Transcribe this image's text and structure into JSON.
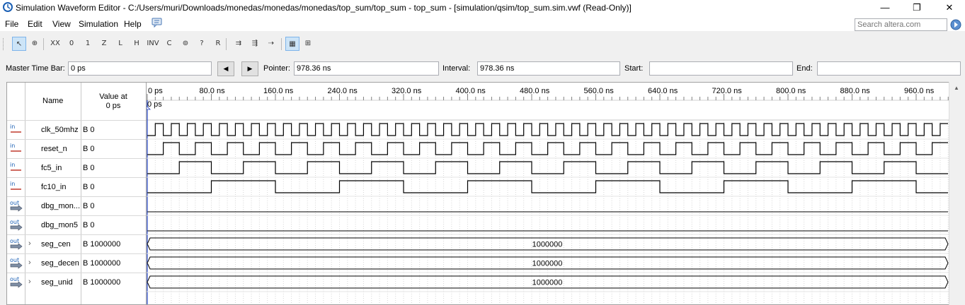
{
  "window": {
    "title": "Simulation Waveform Editor - C:/Users/muri/Downloads/monedas/monedas/monedas/top_sum/top_sum - top_sum - [simulation/qsim/top_sum.sim.vwf (Read-Only)]",
    "minimize": "—",
    "maximize": "❐",
    "close": "✕"
  },
  "menu": [
    "File",
    "Edit",
    "View",
    "Simulation",
    "Help"
  ],
  "search": {
    "placeholder": "Search altera.com"
  },
  "toolbar": {
    "tools": [
      {
        "name": "selection-tool",
        "glyph": "↖"
      },
      {
        "name": "zoom-tool",
        "glyph": "⊕"
      },
      {
        "name": "force-unknown-tool",
        "glyph": "XX"
      },
      {
        "name": "force-low-tool",
        "glyph": "0"
      },
      {
        "name": "force-high-tool",
        "glyph": "1"
      },
      {
        "name": "force-high-z-tool",
        "glyph": "Z"
      },
      {
        "name": "force-weak-low-tool",
        "glyph": "L"
      },
      {
        "name": "force-weak-high-tool",
        "glyph": "H"
      },
      {
        "name": "invert-tool",
        "glyph": "INV"
      },
      {
        "name": "count-value-tool",
        "glyph": "C"
      },
      {
        "name": "overwrite-clock-tool",
        "glyph": "⊚"
      },
      {
        "name": "arbitrary-value-tool",
        "glyph": "?"
      },
      {
        "name": "random-values-tool",
        "glyph": "R"
      },
      {
        "name": "run-functional-simulation-tool",
        "glyph": "⇉"
      },
      {
        "name": "run-timing-simulation-tool",
        "glyph": "⇶"
      },
      {
        "name": "generate-netlist-tool",
        "glyph": "⇢"
      },
      {
        "name": "snap-to-grid-tool",
        "glyph": "▦"
      },
      {
        "name": "grid-settings-tool",
        "glyph": "⊞"
      }
    ]
  },
  "controls": {
    "master_time_bar_label": "Master Time Bar:",
    "master_time_bar_value": "0 ps",
    "prev_glyph": "◀",
    "next_glyph": "▶",
    "pointer_label": "Pointer:",
    "pointer_value": "978.36 ns",
    "interval_label": "Interval:",
    "interval_value": "978.36 ns",
    "start_label": "Start:",
    "start_value": "",
    "end_label": "End:",
    "end_value": ""
  },
  "table": {
    "name_header": "Name",
    "value_header_line1": "Value at",
    "value_header_line2": "0 ps",
    "cursor_label": "0 ps",
    "ruler": [
      "0 ps",
      "80.0 ns",
      "160.0 ns",
      "240.0 ns",
      "320.0 ns",
      "400.0 ns",
      "480.0 ns",
      "560.0 ns",
      "640.0 ns",
      "720.0 ns",
      "800.0 ns",
      "880.0 ns",
      "960.0 ns"
    ],
    "signals": [
      {
        "dir": "in",
        "name": "clk_50mhz",
        "value": "B 0",
        "bus": false,
        "period_ns": 20
      },
      {
        "dir": "in",
        "name": "reset_n",
        "value": "B 0",
        "bus": false,
        "period_ns": 40
      },
      {
        "dir": "in",
        "name": "fc5_in",
        "value": "B 0",
        "bus": false,
        "period_ns": 80
      },
      {
        "dir": "in",
        "name": "fc10_in",
        "value": "B 0",
        "bus": false,
        "period_ns": 160
      },
      {
        "dir": "out",
        "name": "dbg_mon...",
        "value": "B 0",
        "bus": false,
        "period_ns": 0
      },
      {
        "dir": "out",
        "name": "dbg_mon5",
        "value": "B 0",
        "bus": false,
        "period_ns": 0
      },
      {
        "dir": "out",
        "name": "seg_cen",
        "value": "B 1000000",
        "bus": true,
        "bus_value": "1000000"
      },
      {
        "dir": "out",
        "name": "seg_decen",
        "value": "B 1000000",
        "bus": true,
        "bus_value": "1000000"
      },
      {
        "dir": "out",
        "name": "seg_unid",
        "value": "B 1000000",
        "bus": true,
        "bus_value": "1000000"
      }
    ]
  }
}
